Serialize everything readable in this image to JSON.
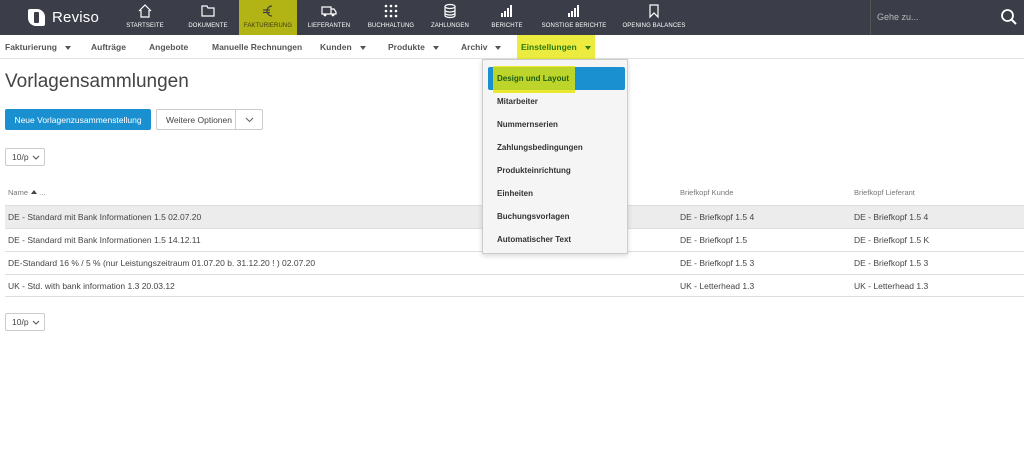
{
  "brand": {
    "name": "Reviso"
  },
  "topnav": {
    "items": [
      {
        "label": "STARTSEITE",
        "icon": "home-icon"
      },
      {
        "label": "DOKUMENTE",
        "icon": "folder-icon"
      },
      {
        "label": "FAKTURIERUNG",
        "icon": "euro-icon",
        "active": true
      },
      {
        "label": "LIEFERANTEN",
        "icon": "truck-icon"
      },
      {
        "label": "BUCHHALTUNG",
        "icon": "grid-icon"
      },
      {
        "label": "ZAHLUNGEN",
        "icon": "coins-icon"
      },
      {
        "label": "BERICHTE",
        "icon": "bar-chart-icon"
      },
      {
        "label": "SONSTIGE BERICHTE",
        "icon": "bar-chart-icon"
      },
      {
        "label": "OPENING BALANCES",
        "icon": "bookmark-icon"
      }
    ],
    "search_placeholder": "Gehe zu..."
  },
  "subnav": {
    "items": [
      {
        "label": "Fakturierung",
        "caret": true
      },
      {
        "label": "Aufträge",
        "caret": false
      },
      {
        "label": "Angebote",
        "caret": false
      },
      {
        "label": "Manuelle Rechnungen",
        "caret": false
      },
      {
        "label": "Kunden",
        "caret": true
      },
      {
        "label": "Produkte",
        "caret": true
      },
      {
        "label": "Archiv",
        "caret": true
      },
      {
        "label": "Einstellungen",
        "caret": true,
        "active": true
      }
    ]
  },
  "page": {
    "title": "Vorlagensammlungen",
    "new_button": "Neue Vorlagenzusammenstellung",
    "more_options": "Weitere Optionen",
    "pager_value": "10/p"
  },
  "table": {
    "headers": {
      "name": "Name",
      "name_more": "...",
      "kunde": "Briefkopf Kunde",
      "lieferant": "Briefkopf Lieferant"
    },
    "rows": [
      {
        "name": "DE - Standard mit Bank Informationen 1.5 02.07.20",
        "kunde": "DE - Briefkopf 1.5 4",
        "lieferant": "DE - Briefkopf 1.5 4"
      },
      {
        "name": "DE - Standard mit Bank Informationen 1.5 14.12.11",
        "kunde": "DE - Briefkopf 1.5",
        "lieferant": "DE - Briefkopf 1.5 K"
      },
      {
        "name": "DE-Standard 16 % / 5 % (nur Leistungszeitraum 01.07.20 b. 31.12.20 ! ) 02.07.20",
        "kunde": "DE - Briefkopf 1.5 3",
        "lieferant": "DE - Briefkopf 1.5 3"
      },
      {
        "name": "UK - Std. with bank information 1.3 20.03.12",
        "kunde": "UK - Letterhead 1.3",
        "lieferant": "UK - Letterhead 1.3"
      }
    ]
  },
  "dropdown": {
    "items": [
      "Design und Layout",
      "Mitarbeiter",
      "Nummernserien",
      "Zahlungsbedingungen",
      "Produkteinrichtung",
      "Einheiten",
      "Buchungsvorlagen",
      "Automatischer Text"
    ]
  },
  "colors": {
    "topbar": "#3b3e49",
    "accent": "#1a90d0",
    "highlight": "#e6e600"
  }
}
